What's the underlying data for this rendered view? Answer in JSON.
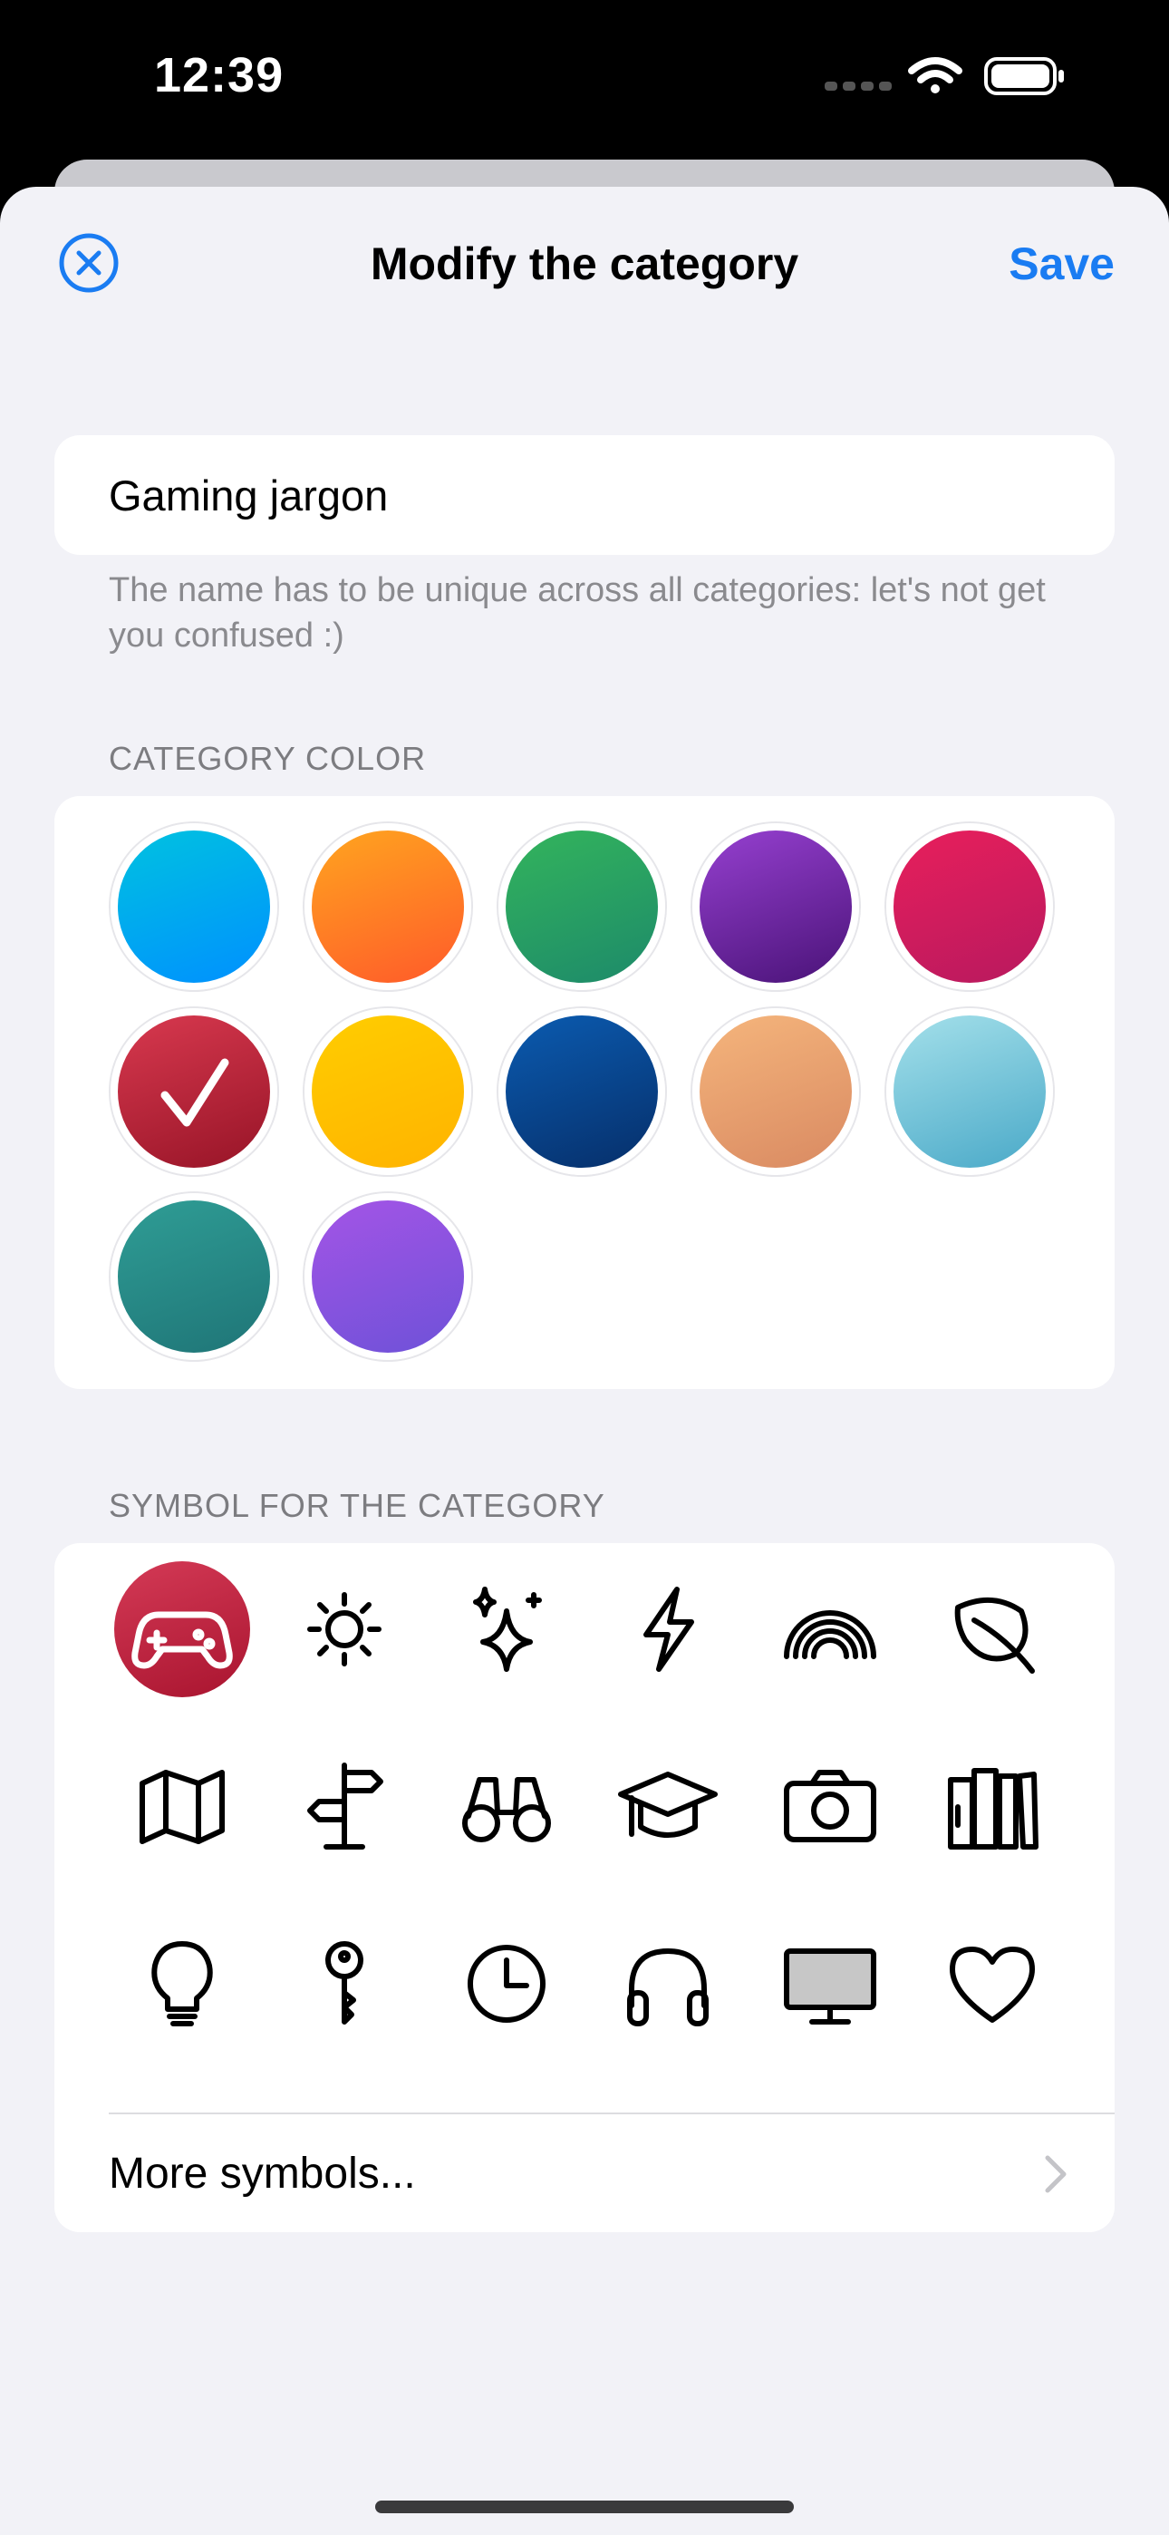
{
  "status_bar": {
    "time": "12:39"
  },
  "nav": {
    "title": "Modify the category",
    "save_label": "Save"
  },
  "name_field": {
    "value": "Gaming jargon",
    "hint": "The name has to be unique across all categories: let's not get you confused :)"
  },
  "colors": {
    "header": "CATEGORY COLOR",
    "selected_index": 5,
    "swatches": [
      {
        "from": "#00c2e0",
        "to": "#0090ff"
      },
      {
        "from": "#ffa51f",
        "to": "#ff5a2a"
      },
      {
        "from": "#33b45c",
        "to": "#1d8a6a"
      },
      {
        "from": "#9640d0",
        "to": "#4a1378"
      },
      {
        "from": "#e81f5c",
        "to": "#b8195e"
      },
      {
        "from": "#d8394f",
        "to": "#971427"
      },
      {
        "from": "#ffcd00",
        "to": "#ffb300"
      },
      {
        "from": "#0b5bb0",
        "to": "#062f6a"
      },
      {
        "from": "#f5b57c",
        "to": "#d98a62"
      },
      {
        "from": "#a4e0ea",
        "to": "#4aa9c8"
      },
      {
        "from": "#2f9d95",
        "to": "#1f7577"
      },
      {
        "from": "#a454e6",
        "to": "#6e52d8"
      }
    ]
  },
  "symbols": {
    "header": "SYMBOL FOR THE CATEGORY",
    "selected_index": 0,
    "selected_color": "#b8203e",
    "items": [
      "gamecontroller-icon",
      "sun-icon",
      "sparkles-icon",
      "bolt-icon",
      "rainbow-icon",
      "leaf-icon",
      "map-icon",
      "signpost-icon",
      "binoculars-icon",
      "graduationcap-icon",
      "camera-icon",
      "books-icon",
      "lightbulb-icon",
      "key-icon",
      "clock-icon",
      "headphones-icon",
      "display-icon",
      "heart-icon"
    ],
    "more_label": "More symbols..."
  },
  "accent_color": "#1a7cf2"
}
